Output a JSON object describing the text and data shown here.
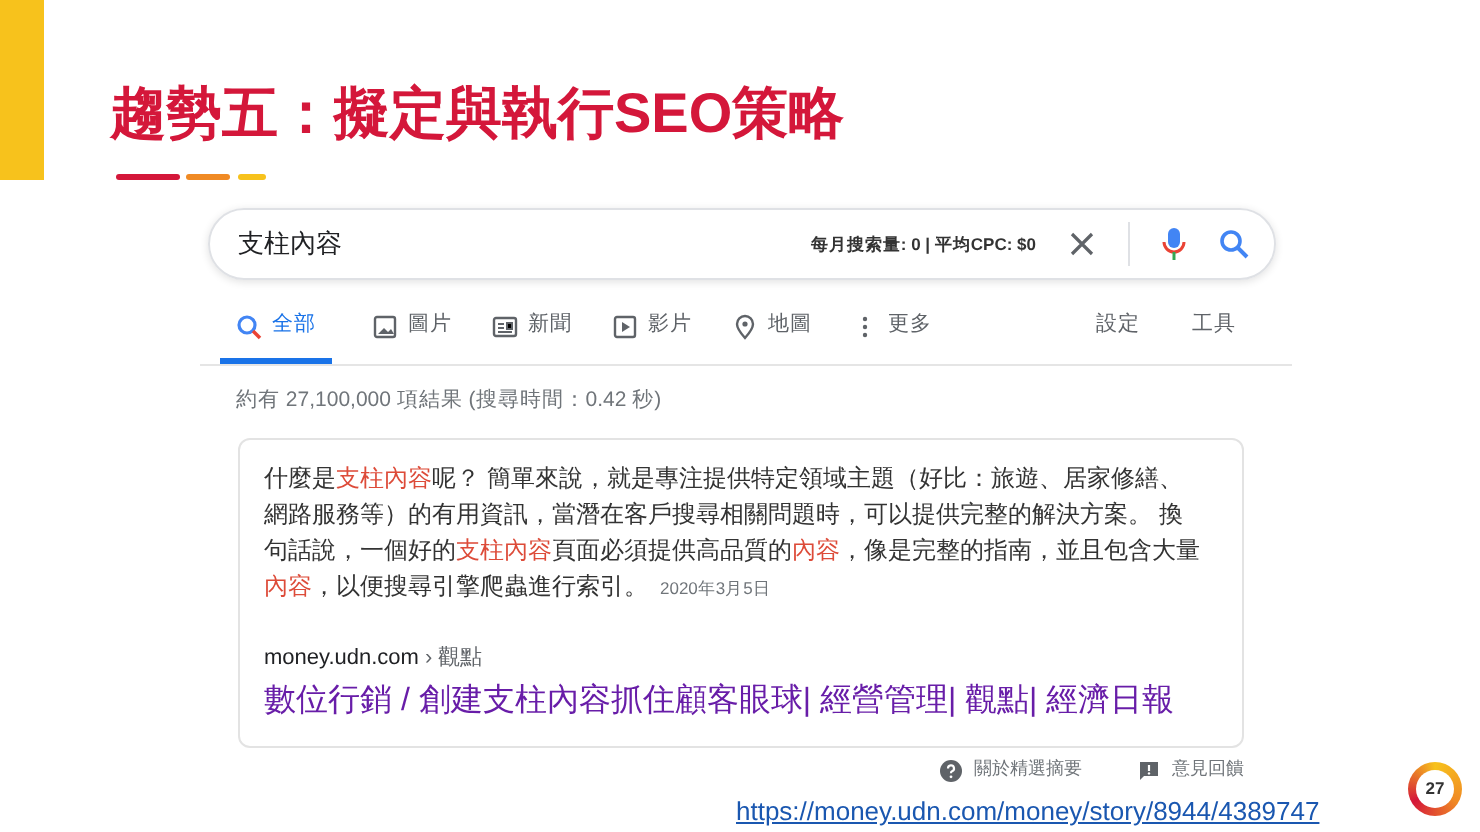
{
  "slide_title": "趨勢五：擬定與執行SEO策略",
  "search": {
    "query": "支柱內容",
    "volume": "每月搜索量: 0 | 平均CPC: $0"
  },
  "tabs": [
    {
      "label": "全部",
      "kind": "search",
      "selected": true
    },
    {
      "label": "圖片",
      "kind": "image",
      "selected": false
    },
    {
      "label": "新聞",
      "kind": "news",
      "selected": false
    },
    {
      "label": "影片",
      "kind": "play",
      "selected": false
    },
    {
      "label": "地圖",
      "kind": "pin",
      "selected": false
    },
    {
      "label": "更多",
      "kind": "dots",
      "selected": false
    }
  ],
  "tools": [
    "設定",
    "工具"
  ],
  "result_stats": "約有 27,100,000 項結果 (搜尋時間：0.42 秒)",
  "snippet": {
    "segments": [
      {
        "text": "什麼是",
        "highlight": false
      },
      {
        "text": "支柱內容",
        "highlight": true
      },
      {
        "text": "呢？ 簡單來說，就是專注提供特定領域主題（好比：旅遊、居家修繕、網路服務等）的有用資訊，當潛在客戶搜尋相關問題時，可以提供完整的解決方案。 換句話說，一個好的",
        "highlight": false
      },
      {
        "text": "支柱內容",
        "highlight": true
      },
      {
        "text": "頁面必須提供高品質的",
        "highlight": false
      },
      {
        "text": "內容",
        "highlight": true
      },
      {
        "text": "，像是完整的指南，並且包含大量",
        "highlight": false
      },
      {
        "text": "內容",
        "highlight": true
      },
      {
        "text": "，以便搜尋引擎爬蟲進行索引。",
        "highlight": false
      }
    ],
    "date": "2020年3月5日",
    "site": "money.udn.com",
    "breadcrumb": "› 觀點",
    "title": "數位行銷 / 創建支柱內容抓住顧客眼球| 經營管理| 觀點| 經濟日報"
  },
  "footer": [
    "關於精選摘要",
    "意見回饋"
  ],
  "source_link": "https://money.udn.com/money/story/8944/4389747",
  "page_number": "27"
}
